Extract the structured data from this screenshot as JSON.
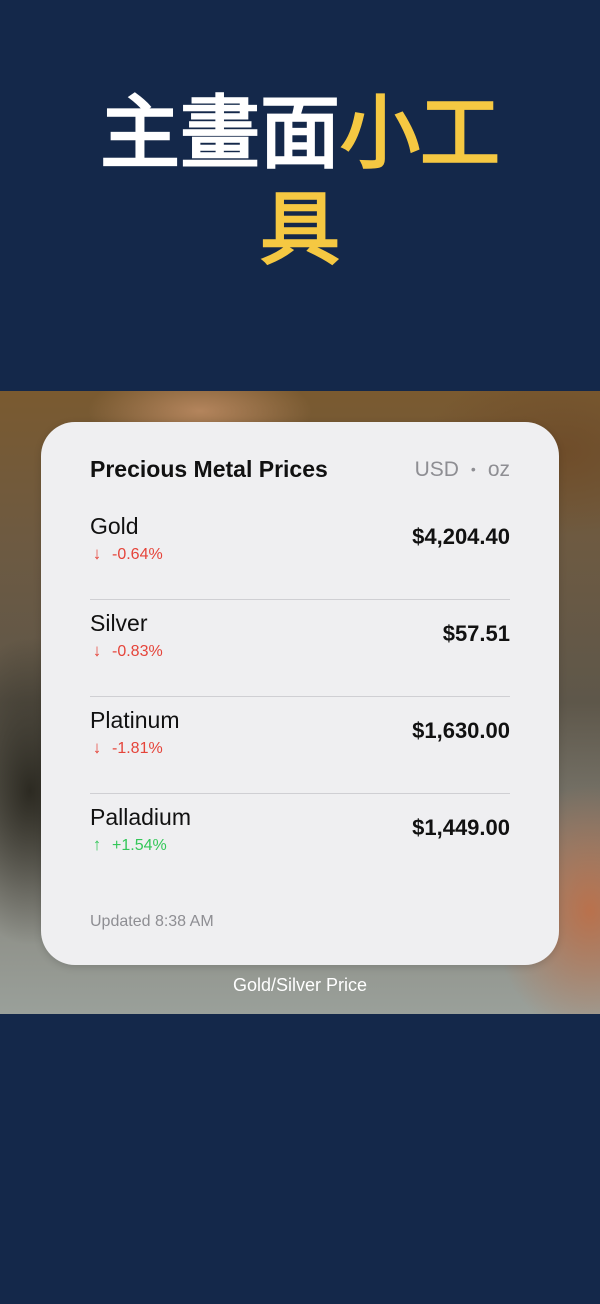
{
  "headline": {
    "part_white": "主畫面",
    "part_yellow_1": "小工",
    "part_yellow_2": "具",
    "colors": {
      "white": "#ffffff",
      "yellow": "#f5c842"
    }
  },
  "widget": {
    "title": "Precious Metal Prices",
    "currency": "USD",
    "separator": "•",
    "unit": "oz",
    "metals": [
      {
        "name": "Gold",
        "direction": "down",
        "arrow_icon": "arrow-down-icon",
        "arrow": "↓",
        "change": "-0.64%",
        "price": "$4,204.40"
      },
      {
        "name": "Silver",
        "direction": "down",
        "arrow_icon": "arrow-down-icon",
        "arrow": "↓",
        "change": "-0.83%",
        "price": "$57.51"
      },
      {
        "name": "Platinum",
        "direction": "down",
        "arrow_icon": "arrow-down-icon",
        "arrow": "↓",
        "change": "-1.81%",
        "price": "$1,630.00"
      },
      {
        "name": "Palladium",
        "direction": "up",
        "arrow_icon": "arrow-up-icon",
        "arrow": "↑",
        "change": "+1.54%",
        "price": "$1,449.00"
      }
    ],
    "updated": "Updated 8:38 AM",
    "colors": {
      "down": "#e5443a",
      "up": "#34c759"
    }
  },
  "caption": "Gold/Silver Price",
  "background_color": "#14284a"
}
